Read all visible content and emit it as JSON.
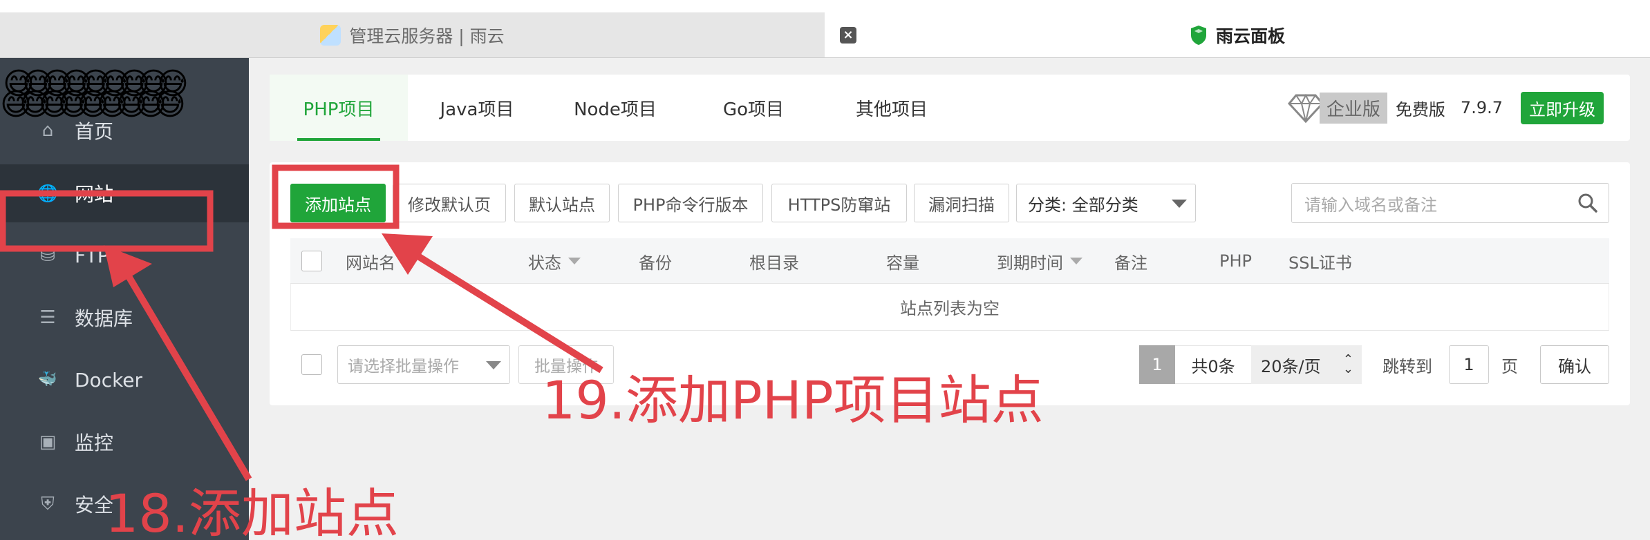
{
  "browser": {
    "tabs": [
      {
        "title": "管理云服务器 | 雨云",
        "active": false
      },
      {
        "title": "雨云面板",
        "active": true
      }
    ],
    "close_glyph": "×"
  },
  "sidebar": {
    "emoji_row1": "😅😅😅😅😅😅😅😅😅",
    "emoji_row2": "😅😅😅😅😅😅😅😅😅",
    "items": [
      {
        "label": "首页",
        "icon": "home-icon",
        "glyph": "⌂"
      },
      {
        "label": "网站",
        "icon": "globe-icon",
        "glyph": "🌐",
        "active": true
      },
      {
        "label": "FTP",
        "icon": "ftp-icon",
        "glyph": "⛁"
      },
      {
        "label": "数据库",
        "icon": "database-icon",
        "glyph": "☰"
      },
      {
        "label": "Docker",
        "icon": "docker-icon",
        "glyph": "🐳"
      },
      {
        "label": "监控",
        "icon": "monitor-icon",
        "glyph": "▣"
      },
      {
        "label": "安全",
        "icon": "shield-icon",
        "glyph": "⛨"
      }
    ]
  },
  "project_tabs": [
    {
      "label": "PHP项目",
      "active": true
    },
    {
      "label": "Java项目"
    },
    {
      "label": "Node项目"
    },
    {
      "label": "Go项目"
    },
    {
      "label": "其他项目"
    }
  ],
  "version": {
    "enterprise": "企业版",
    "free": "免费版",
    "number": "7.9.7",
    "upgrade": "立即升级"
  },
  "toolbar": {
    "add_site": "添加站点",
    "edit_default_page": "修改默认页",
    "default_site": "默认站点",
    "php_cli_version": "PHP命令行版本",
    "https_protect": "HTTPS防窜站",
    "vuln_scan": "漏洞扫描",
    "category": "分类: 全部分类",
    "search_placeholder": "请输入域名或备注"
  },
  "table": {
    "columns": [
      "网站名",
      "状态",
      "备份",
      "根目录",
      "容量",
      "到期时间",
      "备注",
      "PHP",
      "SSL证书"
    ],
    "empty_text": "站点列表为空"
  },
  "footer": {
    "batch_placeholder": "请选择批量操作",
    "batch_button": "批量操作",
    "page": "1",
    "total": "共0条",
    "page_size": "20条/页",
    "jump_label": "跳转到",
    "jump_value": "1",
    "jump_unit": "页",
    "confirm": "确认"
  },
  "annotations": {
    "step18": "18.添加站点",
    "step19": "19.添加PHP项目站点",
    "color": "#e2434a"
  },
  "colors": {
    "accent": "#20a53a",
    "sidebar_bg": "#3c444d",
    "annotation": "#e2434a"
  }
}
